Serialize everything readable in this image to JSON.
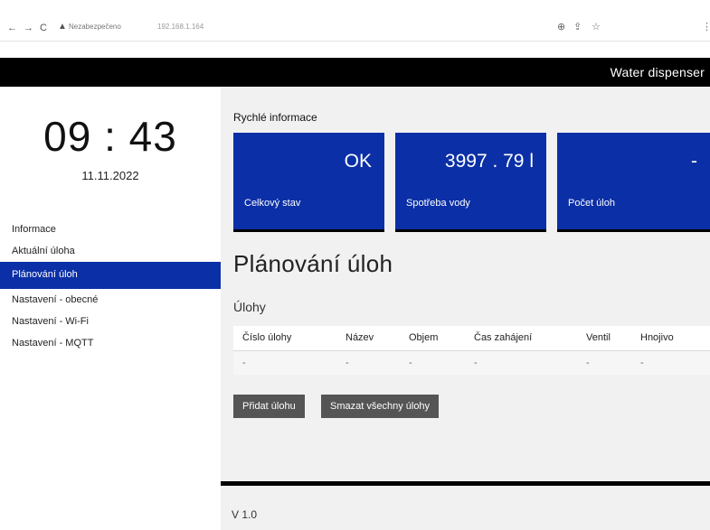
{
  "browser": {
    "back_icon": "←",
    "forward_icon": "→",
    "reload_icon": "C",
    "warning_icon": "▲",
    "security_label": "Nezabezpečeno",
    "url": "192.168.1.164",
    "zoom_icon": "⊕",
    "share_icon": "⇪",
    "star_icon": "☆",
    "menu_icon": "⋮"
  },
  "header": {
    "title": "Water dispenser"
  },
  "sidebar": {
    "clock": "09 : 43",
    "date": "11.11.2022",
    "items": [
      {
        "label": "Informace"
      },
      {
        "label": "Aktuální úloha"
      },
      {
        "label": "Plánování úloh"
      },
      {
        "label": "Nastavení - obecné"
      },
      {
        "label": "Nastavení - Wi-Fi"
      },
      {
        "label": "Nastavení - MQTT"
      }
    ]
  },
  "main": {
    "quick_info_title": "Rychlé informace",
    "cards": [
      {
        "value": "OK",
        "label": "Celkový stav"
      },
      {
        "value": "3997 . 79 l",
        "label": "Spotřeba vody"
      },
      {
        "value": "-",
        "label": "Počet úloh"
      }
    ],
    "page_title": "Plánování úloh",
    "tasks_title": "Úlohy",
    "table": {
      "headers": [
        "Číslo úlohy",
        "Název",
        "Objem",
        "Čas zahájení",
        "Ventil",
        "Hnojivo"
      ],
      "rows": [
        [
          "-",
          "-",
          "-",
          "-",
          "-",
          "-"
        ]
      ]
    },
    "buttons": {
      "add": "Přidat úlohu",
      "delete_all": "Smazat všechny úlohy"
    }
  },
  "footer": {
    "version": "V 1.0"
  },
  "colors": {
    "accent": "#0b2fa6",
    "topbar": "#000000",
    "button": "#555555"
  }
}
